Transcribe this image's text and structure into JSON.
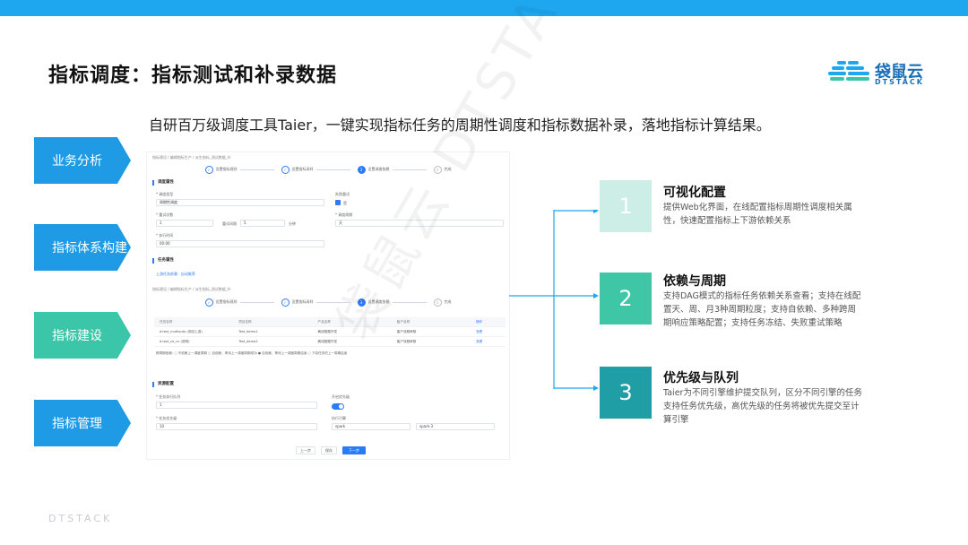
{
  "slide": {
    "title": "指标调度：指标测试和补录数据",
    "subtitle": "自研百万级调度工具Taier，一键实现指标任务的周期性调度和指标数据补录，落地指标计算结果。",
    "footer": "DTSTACK",
    "watermark": "袋鼠云 DTSTACK"
  },
  "logo": {
    "name": "袋鼠云",
    "sub": "DTSTACK"
  },
  "left_tabs": [
    {
      "label": "业务分析"
    },
    {
      "label": "指标体系构建"
    },
    {
      "label": "指标建设"
    },
    {
      "label": "指标管理"
    }
  ],
  "ui": {
    "breadcrumb1": "指标建设 / 编辑指标生产 / 派生指标_测试数据_hl",
    "steps_top": [
      "设置指标规则",
      "设置指标采样",
      "设置调度依赖",
      "完成"
    ],
    "sec_schedule": "调度属性",
    "lbl_schedule_type": "* 调度类型",
    "val_schedule_type": "周期性调度",
    "lbl_retry": "* 重试次数",
    "val_retry": "1",
    "lbl_retry_interval": "重试间隔",
    "val_retry_interval": "5",
    "unit_min": "分钟",
    "lbl_time": "* 执行时间",
    "val_time": "00:00",
    "lbl_fail": "失败重试",
    "cb_fail": "是",
    "lbl_period": "* 调度周期",
    "val_period": "天",
    "sec_dep": "任务属性",
    "dep_hint": "上游任务依赖 · 自动推荐",
    "breadcrumb2": "指标建设 / 编辑指标生产 / 派生指标_测试数据_hl",
    "steps_bottom": [
      "设置指标规则",
      "设置指标采样",
      "设置调度依赖",
      "完成"
    ],
    "table_head": [
      "任务名称",
      "项目名称",
      "产品名称",
      "租户名称",
      "操作"
    ],
    "table_rows": [
      [
        "d.test_mutilauto (测试上游)",
        "Test_demo1",
        "离线数据开发",
        "客户流程审核",
        "查看"
      ],
      [
        "d.test_ce_cn (说明)",
        "Test_demo2",
        "离线数据开发",
        "客户流程审核",
        "查看"
      ]
    ],
    "dep_options": "跨周期依赖: ○ 不依赖上一调度周期  ○ 自依赖，等待上一调度周期成功  ● 自依赖，等待上一调度周期结束  ○ 下游任务的上一周期结束",
    "sec_priority": "资源配置",
    "lbl_queue": "* 任务执行队列",
    "val_queue": "1",
    "lbl_toggle": "开启优先级",
    "lbl_priority": "* 任务优先级",
    "val_priority": "10",
    "lbl_engine": "执行引擎",
    "val_engine": "spark",
    "val_engine2": "spark-3",
    "btn_prev": "上一步",
    "btn_save": "保存",
    "btn_next": "下一步"
  },
  "features": [
    {
      "num": "1",
      "title": "可视化配置",
      "desc": "提供Web化界面，在线配置指标周期性调度相关属性，快速配置指标上下游依赖关系",
      "color": "#cdeee6"
    },
    {
      "num": "2",
      "title": "依赖与周期",
      "desc": "支持DAG模式的指标任务依赖关系查看；支持在线配置天、周、月3种周期粒度；支持自依赖、多种跨周期响应策略配置；支持任务冻结、失败重试策略",
      "color": "#3ec6a7"
    },
    {
      "num": "3",
      "title": "优先级与队列",
      "desc": "Taier为不同引擎维护提交队列，区分不同引擎的任务支持任务优先级，高优先级的任务将被优先提交至计算引擎",
      "color": "#1f9fa5"
    }
  ],
  "colors": {
    "topbar": "#1ea7ef",
    "tab_blue": "#1f9be6",
    "tab_green": "#3cc6a9",
    "primary": "#2a7bf7"
  }
}
